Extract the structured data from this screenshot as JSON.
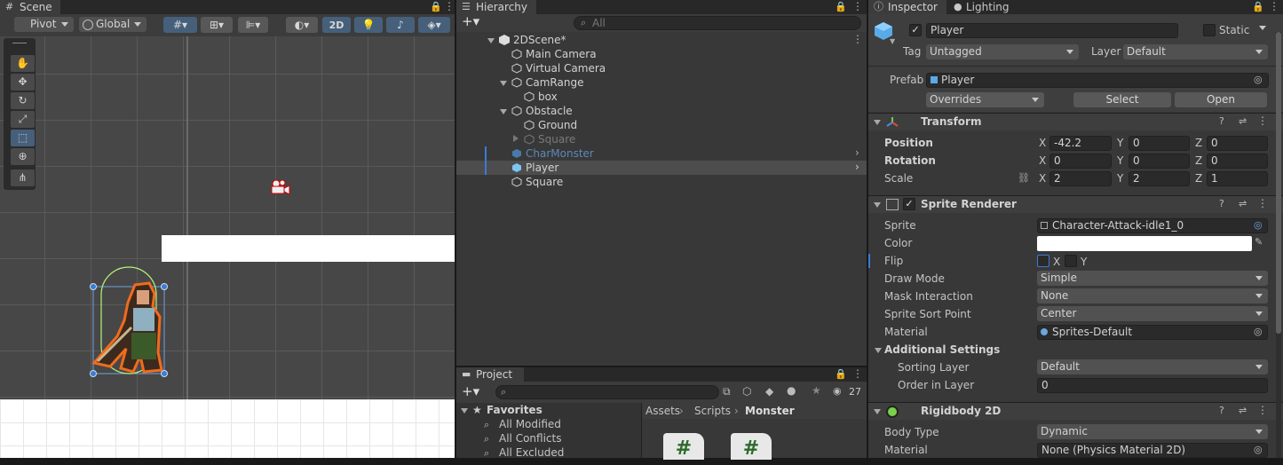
{
  "scene": {
    "tab": "Scene",
    "pivot": "Pivot",
    "global": "Global",
    "mode_2d": "2D"
  },
  "hierarchy": {
    "tab": "Hierarchy",
    "search_placeholder": "All",
    "items": [
      {
        "name": "2DScene*"
      },
      {
        "name": "Main Camera"
      },
      {
        "name": "Virtual Camera"
      },
      {
        "name": "CamRange"
      },
      {
        "name": "box"
      },
      {
        "name": "Obstacle"
      },
      {
        "name": "Ground"
      },
      {
        "name": "Square"
      },
      {
        "name": "CharMonster"
      },
      {
        "name": "Player"
      },
      {
        "name": "Square"
      }
    ]
  },
  "project": {
    "tab": "Project",
    "count": "27",
    "favorites": "Favorites",
    "fav_items": [
      "All Modified",
      "All Conflicts",
      "All Excluded"
    ],
    "breadcrumb": [
      "Assets",
      "Scripts",
      "Monster"
    ]
  },
  "inspector": {
    "tab": "Inspector",
    "lighting_tab": "Lighting",
    "object_name": "Player",
    "static_label": "Static",
    "tag_label": "Tag",
    "tag_value": "Untagged",
    "layer_label": "Layer",
    "layer_value": "Default",
    "prefab_label": "Prefab",
    "prefab_value": "Player",
    "overrides": "Overrides",
    "select": "Select",
    "open": "Open",
    "transform": {
      "title": "Transform",
      "position_label": "Position",
      "rotation_label": "Rotation",
      "scale_label": "Scale",
      "position": {
        "x": "-42.2",
        "y": "0",
        "z": "0"
      },
      "rotation": {
        "x": "0",
        "y": "0",
        "z": "0"
      },
      "scale": {
        "x": "2",
        "y": "2",
        "z": "1"
      }
    },
    "sprite_renderer": {
      "title": "Sprite Renderer",
      "sprite_label": "Sprite",
      "sprite_value": "Character-Attack-idle1_0",
      "color_label": "Color",
      "flip_label": "Flip",
      "flip_x": "X",
      "flip_y": "Y",
      "draw_mode_label": "Draw Mode",
      "draw_mode_value": "Simple",
      "mask_label": "Mask Interaction",
      "mask_value": "None",
      "sort_point_label": "Sprite Sort Point",
      "sort_point_value": "Center",
      "material_label": "Material",
      "material_value": "Sprites-Default",
      "additional_settings": "Additional Settings",
      "sorting_layer_label": "Sorting Layer",
      "sorting_layer_value": "Default",
      "order_label": "Order in Layer",
      "order_value": "0"
    },
    "rigidbody": {
      "title": "Rigidbody 2D",
      "body_type_label": "Body Type",
      "body_type_value": "Dynamic",
      "material_label": "Material",
      "material_value": "None (Physics Material 2D)"
    }
  },
  "colors": {
    "selection": "#2c5d87",
    "orange_outline": "#f26b1d",
    "collider_green": "#b8f27a"
  }
}
